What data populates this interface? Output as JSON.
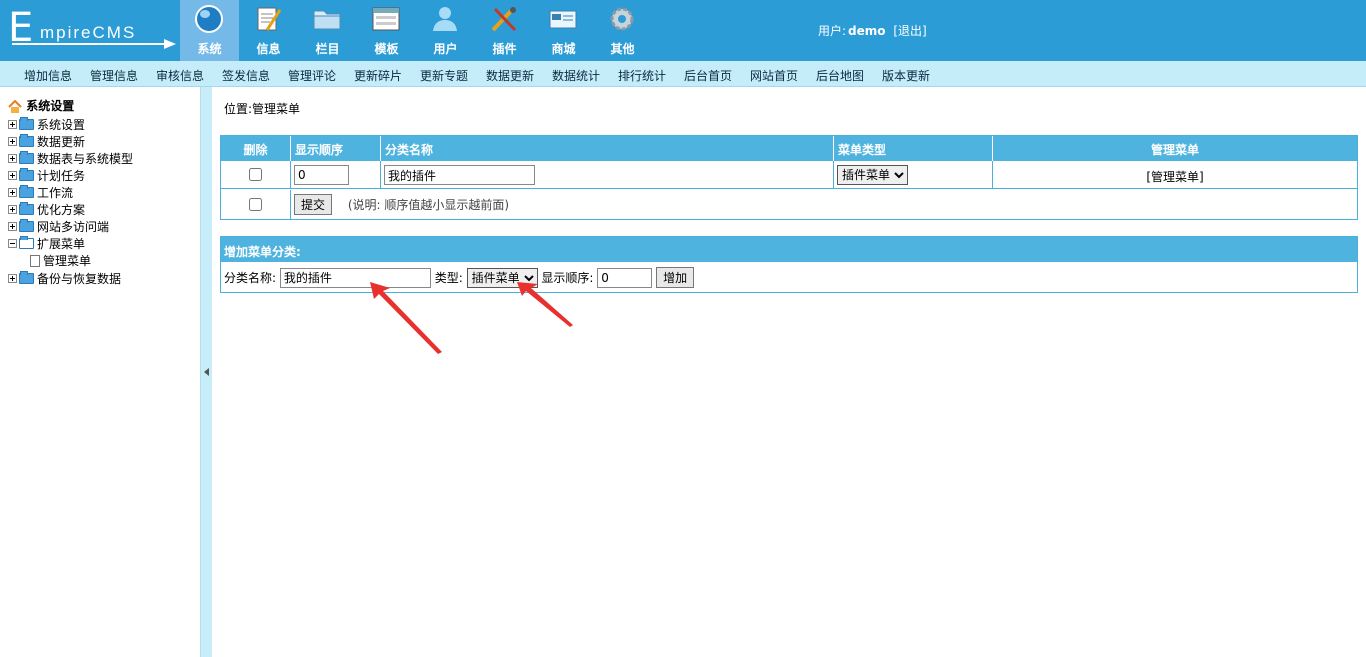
{
  "logo": {
    "text_e": "E",
    "text_rest": "mpireCMS"
  },
  "top_nav": [
    {
      "label": "系统",
      "icon": "globe-icon",
      "active": true
    },
    {
      "label": "信息",
      "icon": "notepad-icon",
      "active": false
    },
    {
      "label": "栏目",
      "icon": "folder-icon",
      "active": false
    },
    {
      "label": "模板",
      "icon": "window-icon",
      "active": false
    },
    {
      "label": "用户",
      "icon": "user-icon",
      "active": false
    },
    {
      "label": "插件",
      "icon": "tools-icon",
      "active": false
    },
    {
      "label": "商城",
      "icon": "card-icon",
      "active": false
    },
    {
      "label": "其他",
      "icon": "gear-icon",
      "active": false
    }
  ],
  "user": {
    "prefix": "用户:",
    "name": "demo",
    "logout": "[退出]"
  },
  "menu_bar": [
    "增加信息",
    "管理信息",
    "审核信息",
    "签发信息",
    "管理评论",
    "更新碎片",
    "更新专题",
    "数据更新",
    "数据统计",
    "排行统计",
    "后台首页",
    "网站首页",
    "后台地图",
    "版本更新"
  ],
  "sidebar": {
    "root": "系统设置",
    "items": [
      {
        "label": "系统设置"
      },
      {
        "label": "数据更新"
      },
      {
        "label": "数据表与系统模型"
      },
      {
        "label": "计划任务"
      },
      {
        "label": "工作流"
      },
      {
        "label": "优化方案"
      },
      {
        "label": "网站多访问端"
      },
      {
        "label": "扩展菜单"
      },
      {
        "label": "管理菜单"
      },
      {
        "label": "备份与恢复数据"
      }
    ]
  },
  "main": {
    "position_label": "位置:",
    "position_link": "管理菜单",
    "list_table": {
      "headers": [
        "删除",
        "显示顺序",
        "分类名称",
        "菜单类型",
        "管理菜单"
      ],
      "row": {
        "order": "0",
        "name": "我的插件",
        "type": "插件菜单",
        "manage": "[管理菜单]"
      },
      "submit": "提交",
      "note": "(说明: 顺序值越小显示越前面)"
    },
    "add_table": {
      "title": "增加菜单分类:",
      "name_label": "分类名称:",
      "name_value": "我的插件",
      "type_label": "类型:",
      "type_value": "插件菜单",
      "order_label": "显示顺序:",
      "order_value": "0",
      "add_button": "增加"
    }
  },
  "colors": {
    "topbar": "#2c9cd6",
    "active_tab": "#74b9e8",
    "menubar": "#c5ecf9",
    "table_header": "#4fb3e0",
    "arrow": "#e8312f"
  }
}
